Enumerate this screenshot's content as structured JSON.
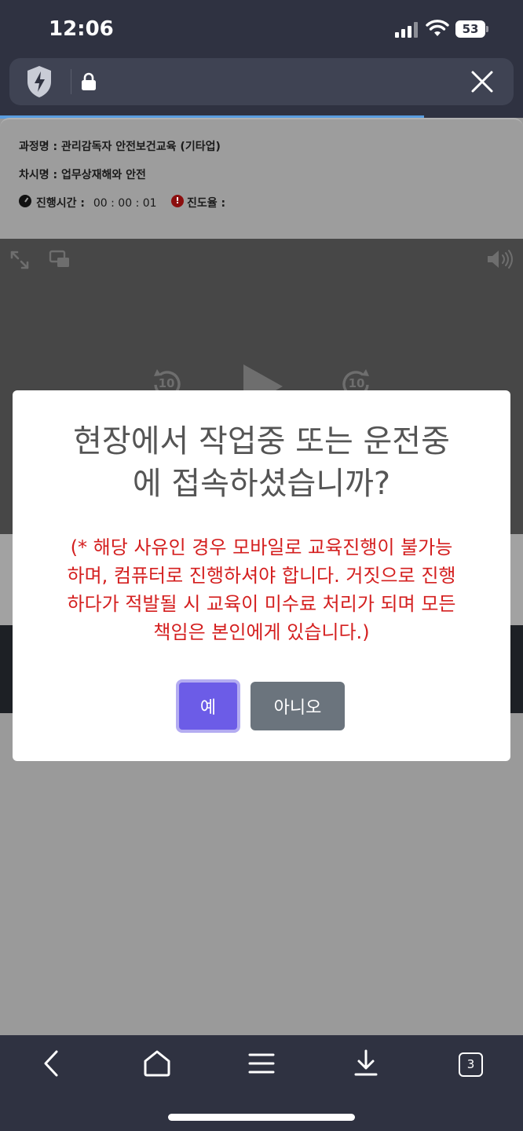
{
  "status_bar": {
    "time": "12:06",
    "battery": "53"
  },
  "browser": {
    "url_icons": [
      "shield-bolt-icon",
      "lock-icon"
    ],
    "close_icon": "close-icon"
  },
  "course_info": {
    "course_label": "과정명 :",
    "course_name": "관리감독자 안전보건교육 (기타업)",
    "session_label": "차시명 :",
    "session_name": "업무상재해와 안전",
    "elapsed_label": "진행시간 :",
    "elapsed_value": "00 : 00 : 01",
    "progress_label": "진도율 :",
    "progress_alert_glyph": "!"
  },
  "player": {
    "rewind_label": "10",
    "forward_label": "10"
  },
  "modal": {
    "title_line1": "현장에서 작업중 또는 운전중",
    "title_line2": "에 접속하셨습니까?",
    "warning_line1": "(* 해당 사유인 경우 모바일로 교육진행이 불가능",
    "warning_line2": "하며, 컴퓨터로 진행하셔야 합니다. 거짓으로 진행",
    "warning_line3": "하다가 적발될 시 교육이 미수료 처리가 되며 모든",
    "warning_line4": "책임은 본인에게 있습니다.)",
    "yes_label": "예",
    "no_label": "아니오"
  },
  "toolbar": {
    "tab_count": "3"
  },
  "colors": {
    "chrome_bg": "#2f3241",
    "yes_button": "#6c5ce7",
    "no_button": "#6b747d",
    "warning_text": "#d41f1f",
    "page_progress": "#5a9de0"
  }
}
